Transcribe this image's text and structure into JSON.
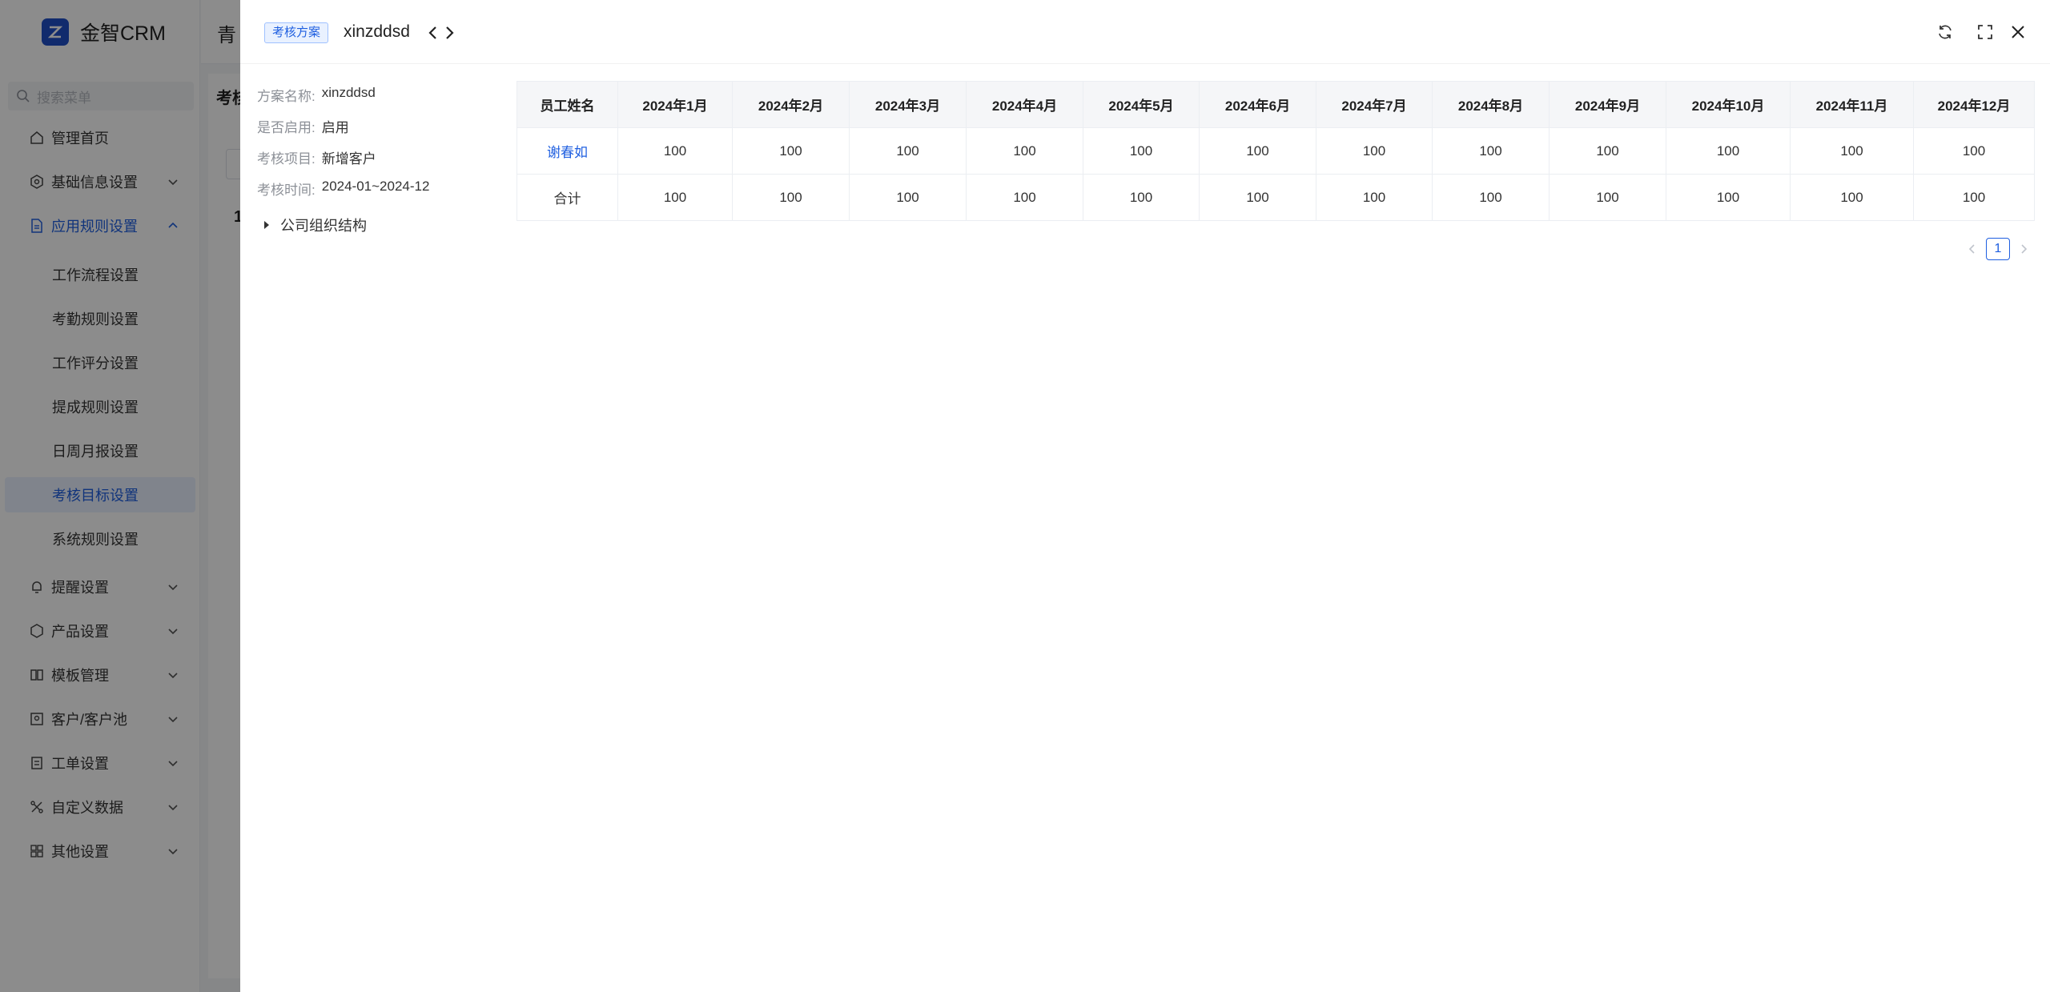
{
  "app": {
    "brand": "金智CRM",
    "topbar_title": "青",
    "content_title": "考核",
    "content_sub": "1",
    "search_placeholder": "搜索菜单"
  },
  "sidebar": {
    "items": [
      {
        "label": "管理首页",
        "icon": "home-icon"
      },
      {
        "label": "基础信息设置",
        "icon": "settings-icon"
      },
      {
        "label": "应用规则设置",
        "icon": "document-icon"
      },
      {
        "label": "提醒设置",
        "icon": "bell-icon"
      },
      {
        "label": "产品设置",
        "icon": "box-icon"
      },
      {
        "label": "模板管理",
        "icon": "template-icon"
      },
      {
        "label": "客户/客户池",
        "icon": "customer-icon"
      },
      {
        "label": "工单设置",
        "icon": "ticket-icon"
      },
      {
        "label": "自定义数据",
        "icon": "custom-data-icon"
      },
      {
        "label": "其他设置",
        "icon": "grid-icon"
      }
    ],
    "subitems": [
      {
        "label": "工作流程设置"
      },
      {
        "label": "考勤规则设置"
      },
      {
        "label": "工作评分设置"
      },
      {
        "label": "提成规则设置"
      },
      {
        "label": "日周月报设置"
      },
      {
        "label": "考核目标设置"
      },
      {
        "label": "系统规则设置"
      }
    ]
  },
  "drawer": {
    "tag": "考核方案",
    "title": "xinzddsd",
    "info": [
      {
        "label": "方案名称:",
        "value": "xinzddsd"
      },
      {
        "label": "是否启用:",
        "value": "启用"
      },
      {
        "label": "考核项目:",
        "value": "新增客户"
      },
      {
        "label": "考核时间:",
        "value": "2024-01~2024-12"
      }
    ],
    "tree_root": "公司组织结构",
    "table": {
      "headers": [
        "员工姓名",
        "2024年1月",
        "2024年2月",
        "2024年3月",
        "2024年4月",
        "2024年5月",
        "2024年6月",
        "2024年7月",
        "2024年8月",
        "2024年9月",
        "2024年10月",
        "2024年11月",
        "2024年12月"
      ],
      "rows": [
        [
          "谢春如",
          "100",
          "100",
          "100",
          "100",
          "100",
          "100",
          "100",
          "100",
          "100",
          "100",
          "100",
          "100"
        ],
        [
          "合计",
          "100",
          "100",
          "100",
          "100",
          "100",
          "100",
          "100",
          "100",
          "100",
          "100",
          "100",
          "100"
        ]
      ]
    },
    "pagination": {
      "current": "1"
    }
  },
  "colors": {
    "accent": "#1f5fe0",
    "mask": "rgba(0,0,0,0.45)"
  }
}
